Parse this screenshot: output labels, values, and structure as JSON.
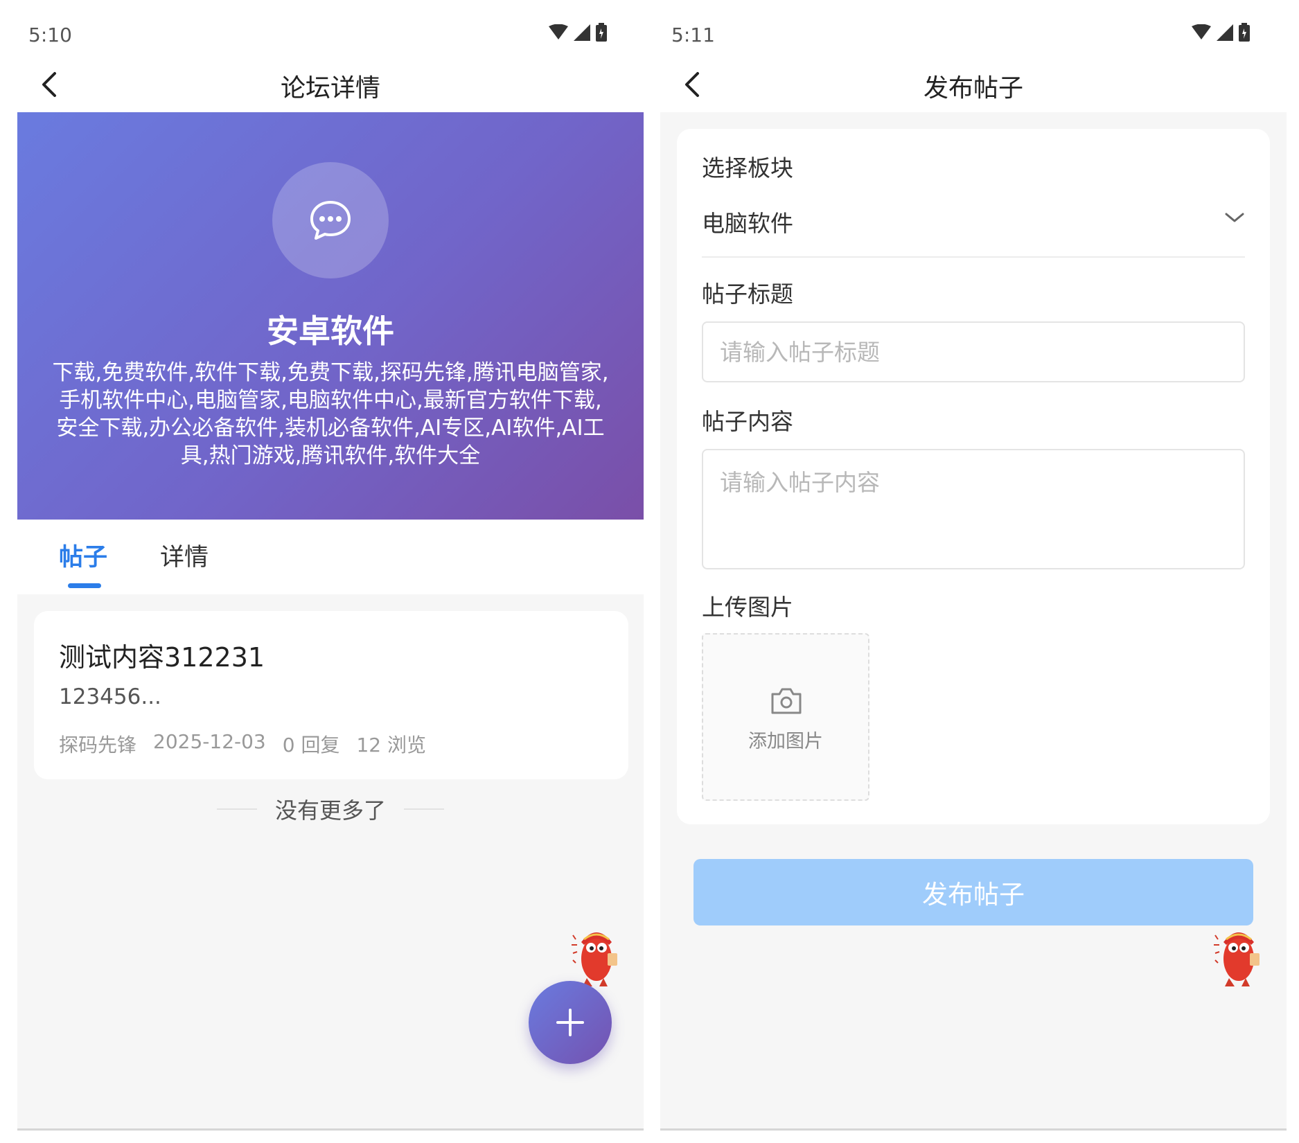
{
  "colors": {
    "accent": "#2b7de9",
    "hero_gradient_start": "#6a7bdf",
    "hero_gradient_end": "#7a4fa8",
    "submit_disabled": "#9fccfb",
    "page_bg": "#f6f6f6"
  },
  "left_screen": {
    "status_bar": {
      "time": "5:10",
      "icons": [
        "wifi-icon",
        "signal-icon",
        "battery-icon"
      ]
    },
    "nav": {
      "back_icon": "chevron-left-icon",
      "title": "论坛详情"
    },
    "forum": {
      "icon": "chat-bubble-icon",
      "name": "安卓软件",
      "description": "下载,免费软件,软件下载,免费下载,探码先锋,腾讯电脑管家,手机软件中心,电脑管家,电脑软件中心,最新官方软件下载,安全下载,办公必备软件,装机必备软件,AI专区,AI软件,AI工具,热门游戏,腾讯软件,软件大全"
    },
    "tabs": [
      {
        "label": "帖子",
        "active": true
      },
      {
        "label": "详情",
        "active": false
      }
    ],
    "posts": [
      {
        "title": "测试内容312231",
        "excerpt": "123456...",
        "author": "探码先锋",
        "date": "2025-12-03",
        "replies": "0 回复",
        "views": "12 浏览"
      }
    ],
    "no_more_text": "没有更多了",
    "fab_icon": "plus-icon"
  },
  "right_screen": {
    "status_bar": {
      "time": "5:11",
      "icons": [
        "wifi-icon",
        "signal-icon",
        "battery-icon"
      ]
    },
    "nav": {
      "back_icon": "chevron-left-icon",
      "title": "发布帖子"
    },
    "form": {
      "section_label": "选择板块",
      "section_value": "电脑软件",
      "title_label": "帖子标题",
      "title_placeholder": "请输入帖子标题",
      "content_label": "帖子内容",
      "content_placeholder": "请输入帖子内容",
      "image_label": "上传图片",
      "add_image_text": "添加图片",
      "submit_label": "发布帖子"
    }
  }
}
